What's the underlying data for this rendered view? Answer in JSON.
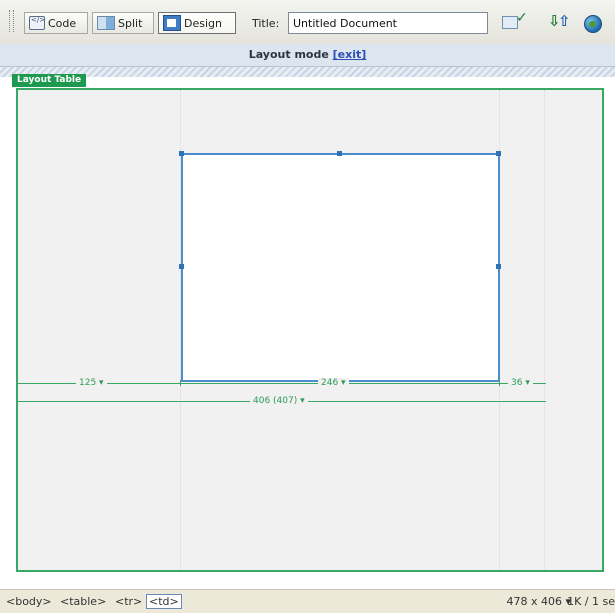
{
  "toolbar": {
    "buttons": [
      {
        "label": "Code",
        "icon": "code-view-icon"
      },
      {
        "label": "Split",
        "icon": "split-view-icon"
      },
      {
        "label": "Design",
        "icon": "design-view-icon"
      }
    ],
    "title_label": "Title:",
    "title_value": "Untitled Document",
    "icons": [
      "validate-markup-icon",
      "file-management-icon",
      "preview-in-browser-icon"
    ]
  },
  "layout_bar": {
    "text": "Layout mode",
    "exit_label": "[exit]"
  },
  "layout_table": {
    "tab_label": "Layout Table",
    "columns": [
      {
        "width_label": "125 ▾"
      },
      {
        "width_label": "246 ▾"
      },
      {
        "width_label": "36 ▾"
      }
    ],
    "total_width_label": "406 (407) ▾"
  },
  "status_bar": {
    "tags": [
      "<body>",
      "<table>",
      "<tr>",
      "<td>"
    ],
    "window_size": "478 x 406 ▾",
    "file_size": "1K / 1 se"
  },
  "colors": {
    "layout_table_border": "#38a864",
    "layout_cell_border": "#4a8ed0",
    "layout_tab_bg": "#1e9a50",
    "exit_link": "#2b4fb5"
  }
}
